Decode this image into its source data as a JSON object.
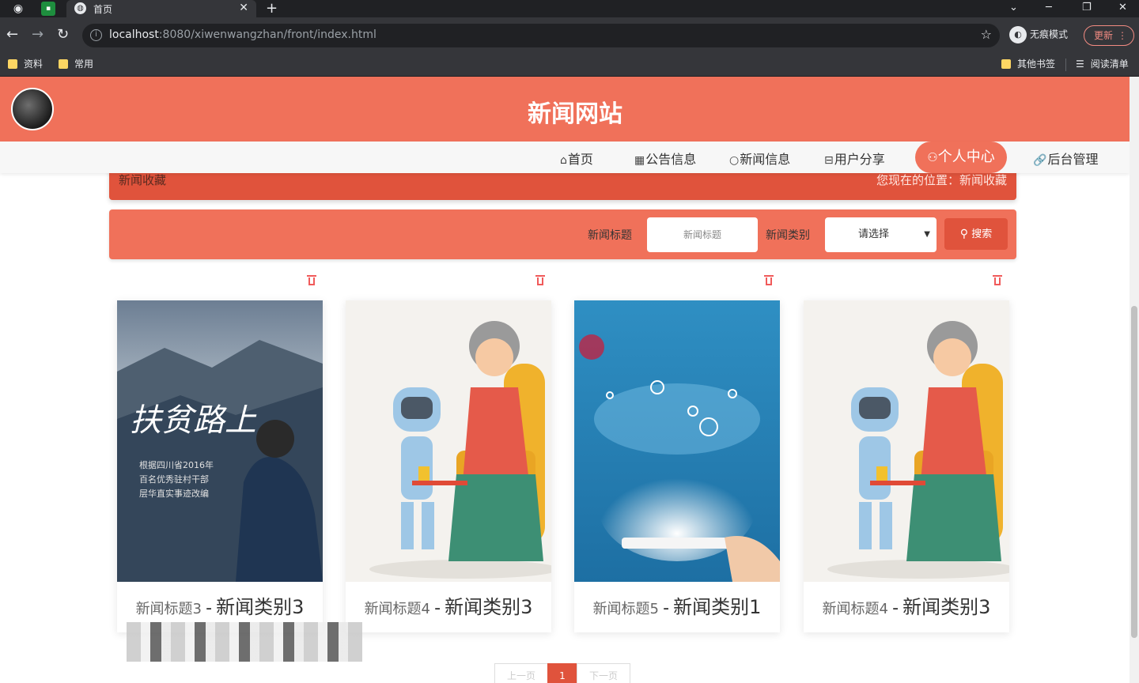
{
  "browser": {
    "tab_title": "首页",
    "new_tab_symbol": "+",
    "url_host": "localhost",
    "url_rest": ":8080/xiwenwangzhan/front/index.html",
    "incognito_label": "无痕模式",
    "update_label": "更新",
    "bookmarks": [
      "资料",
      "常用"
    ],
    "bookmarks_right": [
      "其他书签",
      "阅读清单"
    ]
  },
  "site": {
    "title": "新闻网站",
    "nav": [
      {
        "glyph": "⌂",
        "label": "首页"
      },
      {
        "glyph": "▦",
        "label": "公告信息"
      },
      {
        "glyph": "○",
        "label": "新闻信息"
      },
      {
        "glyph": "⊟",
        "label": "用户分享"
      },
      {
        "glyph": "⚇",
        "label": "个人中心"
      },
      {
        "glyph": "🔗",
        "label": "后台管理"
      }
    ],
    "active_nav": "个人中心"
  },
  "breadcrumb": {
    "page_name": "新闻收藏",
    "location": "您现在的位置：新闻收藏"
  },
  "search": {
    "title_label": "新闻标题",
    "title_placeholder": "新闻标题",
    "category_label": "新闻类别",
    "category_selected": "请选择",
    "button_label": "搜索"
  },
  "cards": [
    {
      "title": "新闻标题3",
      "separator": "-",
      "category": "新闻类别3",
      "image": "mountain-poverty-poster"
    },
    {
      "title": "新闻标题4",
      "separator": "-",
      "category": "新闻类别3",
      "image": "robot-grandma"
    },
    {
      "title": "新闻标题5",
      "separator": "-",
      "category": "新闻类别1",
      "image": "network-tablet"
    },
    {
      "title": "新闻标题4",
      "separator": "-",
      "category": "新闻类别3",
      "image": "robot-grandma"
    }
  ],
  "pagination": {
    "prev": "上一页",
    "current": "1",
    "next": "下一页"
  },
  "poster_text": {
    "big": "扶贫路上",
    "line1": "根据四川省2016年",
    "line2": "百名优秀驻村干部",
    "line3": "层华直实事迹改编"
  },
  "colors": {
    "header": "#f0715a",
    "accent": "#e0533c"
  }
}
